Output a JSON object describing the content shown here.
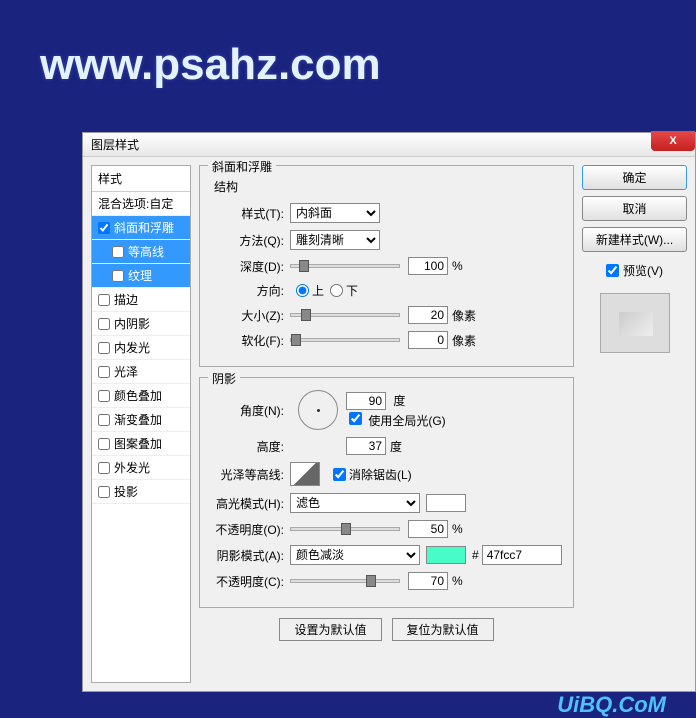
{
  "watermark": "www.psahz.com",
  "bottom_watermark": "UiBQ.CoM",
  "dialog": {
    "title": "图层样式",
    "close_label": "X"
  },
  "styles": {
    "header": "样式",
    "blend_options": "混合选项:自定",
    "bevel": "斜面和浮雕",
    "contour": "等高线",
    "texture": "纹理",
    "stroke": "描边",
    "inner_shadow": "内阴影",
    "inner_glow": "内发光",
    "satin": "光泽",
    "color_overlay": "颜色叠加",
    "gradient_overlay": "渐变叠加",
    "pattern_overlay": "图案叠加",
    "outer_glow": "外发光",
    "drop_shadow": "投影"
  },
  "bevel": {
    "fieldset_title": "斜面和浮雕",
    "structure_title": "结构",
    "style_label": "样式(T):",
    "style_value": "内斜面",
    "technique_label": "方法(Q):",
    "technique_value": "雕刻清晰",
    "depth_label": "深度(D):",
    "depth_value": "100",
    "depth_unit": "%",
    "direction_label": "方向:",
    "direction_up": "上",
    "direction_down": "下",
    "size_label": "大小(Z):",
    "size_value": "20",
    "size_unit": "像素",
    "soften_label": "软化(F):",
    "soften_value": "0",
    "soften_unit": "像素"
  },
  "shading": {
    "fieldset_title": "阴影",
    "angle_label": "角度(N):",
    "angle_value": "90",
    "angle_unit": "度",
    "global_light": "使用全局光(G)",
    "altitude_label": "高度:",
    "altitude_value": "37",
    "altitude_unit": "度",
    "gloss_label": "光泽等高线:",
    "antialiased": "消除锯齿(L)",
    "highlight_mode_label": "高光模式(H):",
    "highlight_mode_value": "滤色",
    "highlight_opacity_label": "不透明度(O):",
    "highlight_opacity_value": "50",
    "highlight_opacity_unit": "%",
    "shadow_mode_label": "阴影模式(A):",
    "shadow_mode_value": "颜色减淡",
    "shadow_opacity_label": "不透明度(C):",
    "shadow_opacity_value": "70",
    "shadow_opacity_unit": "%",
    "hex_prefix": "#",
    "hex_value": "47fcc7"
  },
  "buttons": {
    "make_default": "设置为默认值",
    "reset_default": "复位为默认值"
  },
  "right": {
    "ok": "确定",
    "cancel": "取消",
    "new_style": "新建样式(W)...",
    "preview": "预览(V)"
  }
}
